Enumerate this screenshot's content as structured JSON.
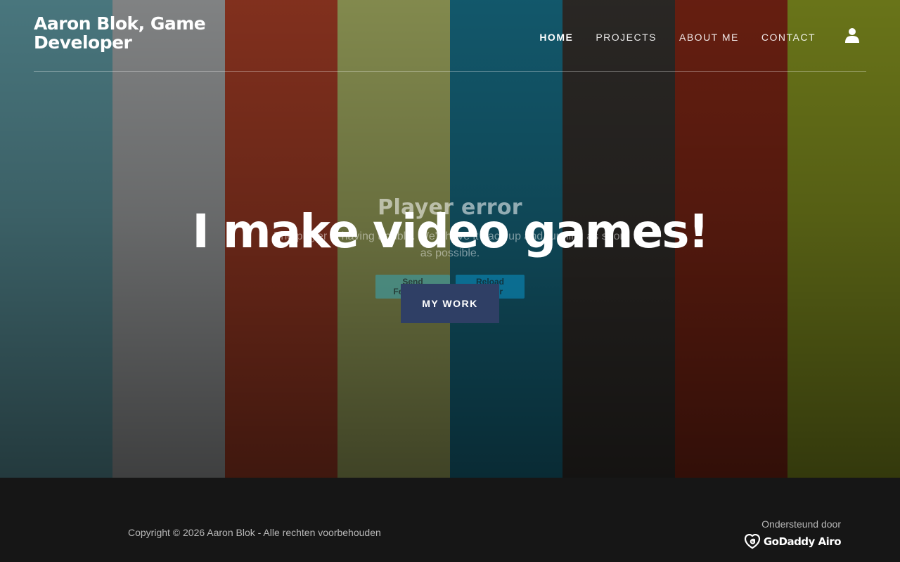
{
  "header": {
    "site_title": "Aaron Blok, Game Developer",
    "nav": [
      {
        "label": "HOME",
        "active": true
      },
      {
        "label": "PROJECTS",
        "active": false
      },
      {
        "label": "ABOUT ME",
        "active": false
      },
      {
        "label": "CONTACT",
        "active": false
      }
    ],
    "account_icon": "person-icon"
  },
  "hero": {
    "stripe_colors": [
      "#4f8088",
      "#8b8d8e",
      "#8c3420",
      "#8d9554",
      "#145f74",
      "#2d2a27",
      "#6e2112",
      "#727e1b"
    ],
    "player_error": {
      "title": "Player error",
      "message": "The player is having trouble. We'll have it back up and running as soon as possible.",
      "send_feedback_label": "Send Feedback",
      "reload_label": "Reload Player"
    },
    "headline": "I make video games!",
    "cta_label": "MY WORK",
    "cta_color": "#2f3f65"
  },
  "footer": {
    "copyright": "Copyright © 2026 Aaron Blok - Alle rechten voorbehouden",
    "powered_by": "Ondersteund door",
    "brand": "GoDaddy Airo"
  }
}
